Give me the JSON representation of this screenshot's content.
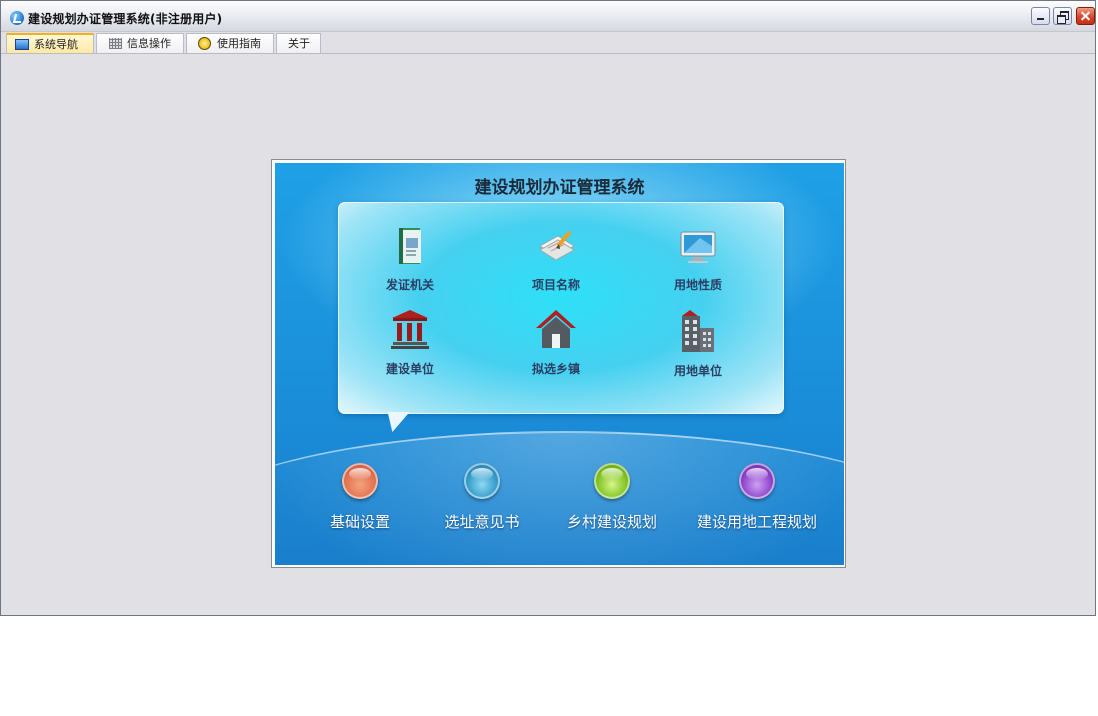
{
  "window": {
    "title": "建设规划办证管理系统(非注册用户)"
  },
  "tabs": [
    {
      "label": "系统导航",
      "icon": "monitor-icon",
      "active": true
    },
    {
      "label": "信息操作",
      "icon": "grid-icon",
      "active": false
    },
    {
      "label": "使用指南",
      "icon": "lightbulb-icon",
      "active": false
    },
    {
      "label": "关于",
      "icon": "",
      "active": false
    }
  ],
  "panel": {
    "title": "建设规划办证管理系统",
    "items": [
      {
        "label": "发证机关",
        "icon": "book-icon"
      },
      {
        "label": "项目名称",
        "icon": "documents-pencil-icon"
      },
      {
        "label": "用地性质",
        "icon": "monitor-icon"
      },
      {
        "label": "建设单位",
        "icon": "bank-building-icon"
      },
      {
        "label": "拟选乡镇",
        "icon": "house-icon"
      },
      {
        "label": "用地单位",
        "icon": "office-building-icon"
      }
    ],
    "buttons": [
      {
        "label": "基础设置",
        "color": "#e0704e"
      },
      {
        "label": "选址意见书",
        "color": "#2f98c8"
      },
      {
        "label": "乡村建设规划",
        "color": "#7cc01e"
      },
      {
        "label": "建设用地工程规划",
        "color": "#8a3fc8"
      }
    ]
  }
}
